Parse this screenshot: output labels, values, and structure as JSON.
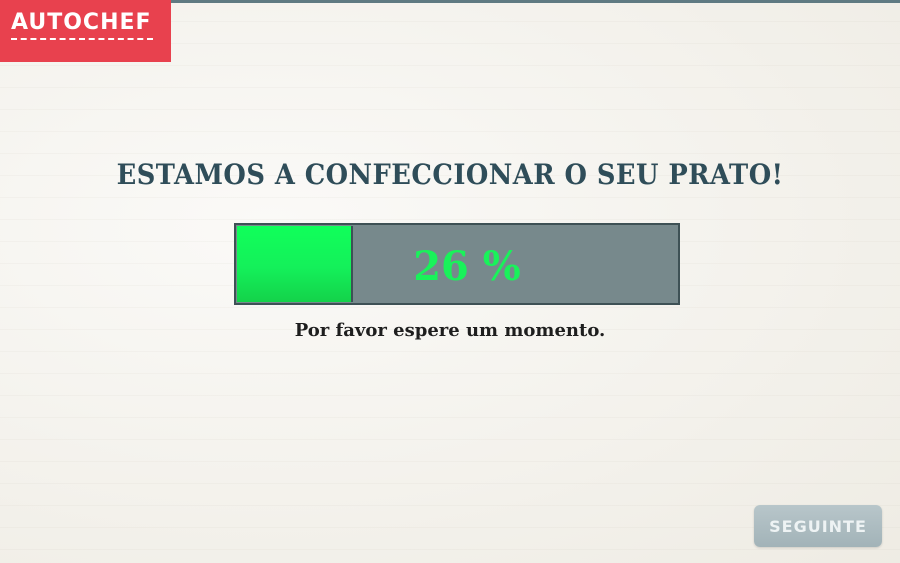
{
  "app": {
    "logo_text": "AUTOCHEF",
    "brand_color": "#e8414e"
  },
  "main": {
    "headline": "ESTAMOS A CONFECCIONAR O SEU PRATO!",
    "progress": {
      "value": 0.26,
      "label": "26 %",
      "fill_color": "#14f05a",
      "track_color": "#77898c"
    },
    "subtext": "Por favor espere um momento."
  },
  "footer": {
    "next_label": "SEGUINTE"
  }
}
